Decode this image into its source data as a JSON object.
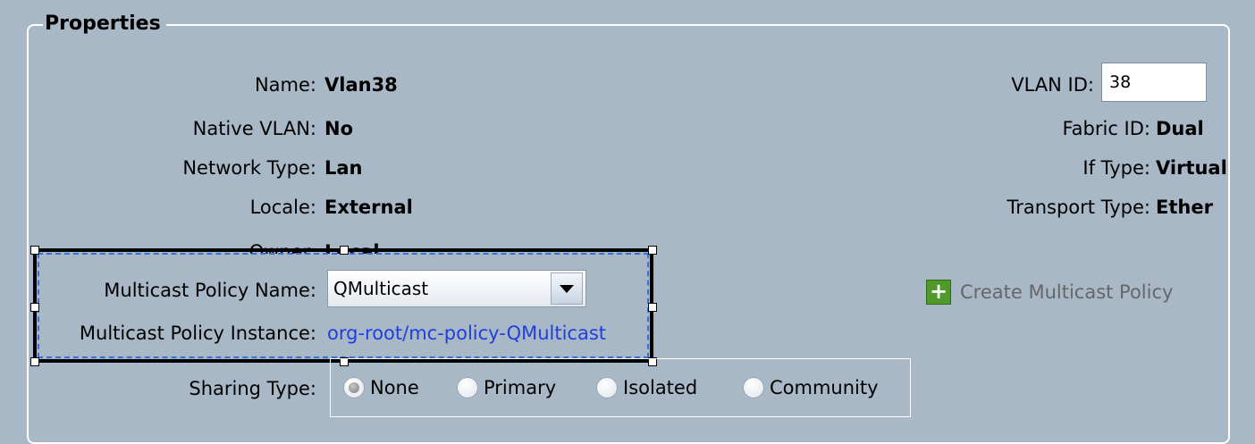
{
  "panel": {
    "title": "Properties"
  },
  "left_fields": [
    {
      "label": "Name:",
      "value": "Vlan38"
    },
    {
      "label": "Native VLAN:",
      "value": "No"
    },
    {
      "label": "Network Type:",
      "value": "Lan"
    },
    {
      "label": "Locale:",
      "value": "External"
    },
    {
      "label": "Owner:",
      "value": "Local"
    }
  ],
  "right_fields": [
    {
      "label": "VLAN ID:",
      "value": "38"
    },
    {
      "label": "Fabric ID:",
      "value": "Dual"
    },
    {
      "label": "If Type:",
      "value": "Virtual"
    },
    {
      "label": "Transport Type:",
      "value": "Ether"
    }
  ],
  "multicast": {
    "policy_name_label": "Multicast Policy Name:",
    "policy_name_value": "QMulticast",
    "instance_label": "Multicast Policy Instance:",
    "instance_value": "org-root/mc-policy-QMulticast"
  },
  "create_policy": {
    "label": "Create Multicast Policy",
    "icon": "plus-icon",
    "icon_color": "#4f9a2a"
  },
  "sharing": {
    "label": "Sharing Type:",
    "options": [
      "None",
      "Primary",
      "Isolated",
      "Community"
    ],
    "selected": "None"
  }
}
